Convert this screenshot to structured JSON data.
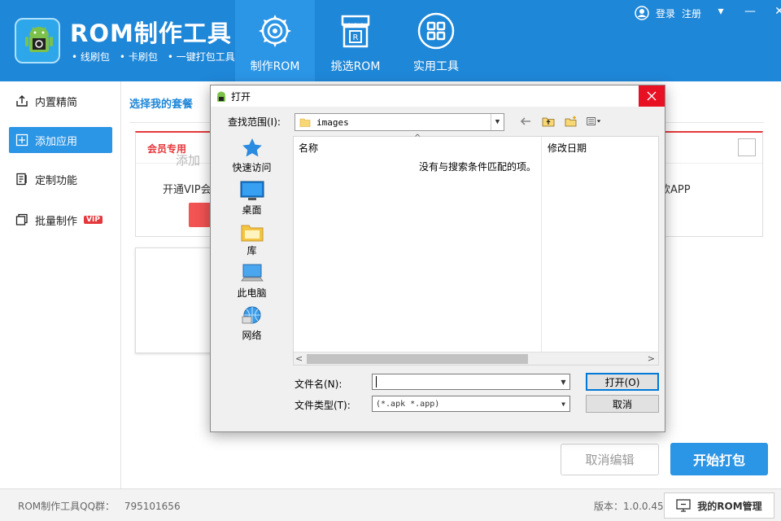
{
  "header": {
    "title": "ROM制作工具",
    "tags": [
      "线刷包",
      "卡刷包",
      "一键打包工具"
    ],
    "tabs": [
      {
        "label": "制作ROM",
        "icon": "gear-icon"
      },
      {
        "label": "挑选ROM",
        "icon": "store-icon"
      },
      {
        "label": "实用工具",
        "icon": "grid-icon"
      }
    ],
    "login": "登录",
    "register": "注册",
    "window_controls": [
      "▾",
      "—",
      "✕"
    ]
  },
  "sidebar": {
    "items": [
      {
        "label": "内置精简",
        "icon": "upload-icon"
      },
      {
        "label": "添加应用",
        "icon": "add-icon"
      },
      {
        "label": "定制功能",
        "icon": "document-icon"
      },
      {
        "label": "批量制作",
        "icon": "batch-icon",
        "badge": "VIP"
      }
    ]
  },
  "main": {
    "section_title": "选择我的套餐",
    "vip_card_title": "会员专用",
    "vip_card_text": "开通VIP会员",
    "vip_card_right_text": "款APP",
    "add_card_text": "添加",
    "cancel_edit": "取消编辑",
    "start_pack": "开始打包"
  },
  "footer": {
    "qq_label": "ROM制作工具QQ群：",
    "qq_number": "795101656",
    "version": "版本：1.0.0.45",
    "my_rom": "我的ROM管理"
  },
  "dialog": {
    "title": "打开",
    "look_in_label": "查找范围(I):",
    "look_in_value": "images",
    "places": [
      "快速访问",
      "桌面",
      "库",
      "此电脑",
      "网络"
    ],
    "col_name": "名称",
    "col_date": "修改日期",
    "empty_message": "没有与搜索条件匹配的项。",
    "file_name_label": "文件名(N):",
    "file_name_value": "",
    "file_type_label": "文件类型(T):",
    "file_type_value": "(*.apk *.app)",
    "open_button": "打开(O)",
    "cancel_button": "取消"
  },
  "colors": {
    "primary": "#1f87d8",
    "accent": "#2b95e6",
    "danger": "#e5383b"
  }
}
